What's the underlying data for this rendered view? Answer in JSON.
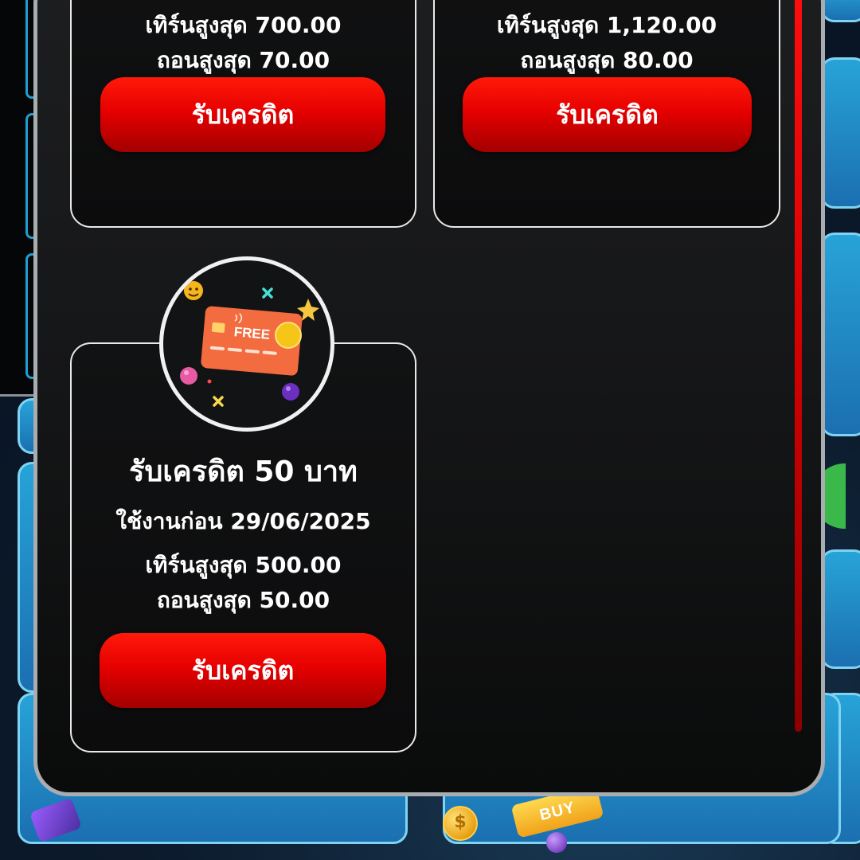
{
  "cards": [
    {
      "max_turnover": "เทิร์นสูงสุด 700.00",
      "max_withdraw": "ถอนสูงสุด 70.00",
      "button_label": "รับเครดิต"
    },
    {
      "max_turnover": "เทิร์นสูงสุด 1,120.00",
      "max_withdraw": "ถอนสูงสุด 80.00",
      "button_label": "รับเครดิต"
    },
    {
      "promo_image_label": "FREE",
      "title": "รับเครดิต 50 บาท",
      "expiry": "ใช้งานก่อน 29/06/2025",
      "max_turnover": "เทิร์นสูงสุด 500.00",
      "max_withdraw": "ถอนสูงสุด 50.00",
      "button_label": "รับเครดิต"
    }
  ],
  "background": {
    "buy_label": "BUY",
    "coin_symbol": "$"
  },
  "colors": {
    "accent_red": "#e60000",
    "scrollbar_red": "#ff0d0d",
    "card_border": "#e9e9e9",
    "modal_border": "#a9adb1"
  },
  "icons": {
    "promo": "free-credit-card-icon",
    "coin": "dollar-coin-icon"
  }
}
